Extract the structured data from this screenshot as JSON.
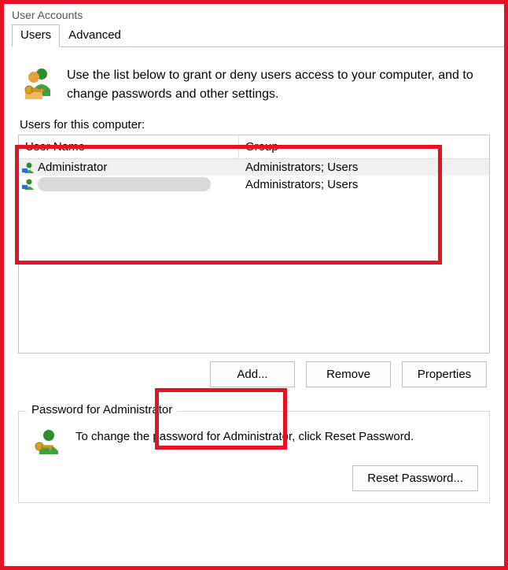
{
  "window": {
    "title": "User Accounts"
  },
  "tabs": {
    "users": "Users",
    "advanced": "Advanced"
  },
  "intro": "Use the list below to grant or deny users access to your computer, and to change passwords and other settings.",
  "usersSection": {
    "label": "Users for this computer:",
    "headerName": "User Name",
    "headerGroup": "Group",
    "rows": [
      {
        "name": "Administrator",
        "group": "Administrators; Users"
      },
      {
        "name": "",
        "group": "Administrators; Users"
      }
    ]
  },
  "buttons": {
    "add": "Add...",
    "remove": "Remove",
    "properties": "Properties"
  },
  "passwordSection": {
    "legend": "Password for Administrator",
    "text": "To change the password for Administrator, click Reset Password.",
    "reset": "Reset Password..."
  }
}
